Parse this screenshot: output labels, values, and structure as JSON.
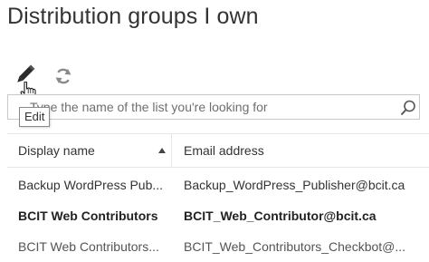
{
  "page": {
    "title": "Distribution groups I own"
  },
  "toolbar": {
    "edit_icon": "pencil-icon",
    "refresh_icon": "refresh-icon",
    "tooltip": "Edit"
  },
  "search": {
    "placeholder": "Type the name of the list you're looking for",
    "icon": "search-icon"
  },
  "table": {
    "columns": [
      "Display name",
      "Email address"
    ],
    "sort": "ascending",
    "rows": [
      {
        "name": "Backup WordPress Pub...",
        "email": "Backup_WordPress_Publisher@bcit.ca"
      },
      {
        "name": "BCIT Web Contributors",
        "email": "BCIT_Web_Contributor@bcit.ca"
      },
      {
        "name": "BCIT Web Contributors...",
        "email": "BCIT_Web_Contributors_Checkbot@..."
      }
    ]
  },
  "colors": {
    "text": "#333333",
    "border": "#c8c8c8",
    "icon": "#707070"
  }
}
